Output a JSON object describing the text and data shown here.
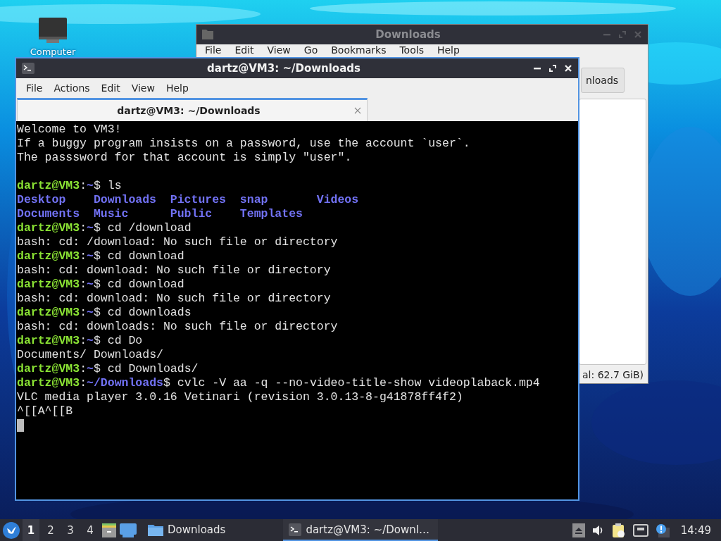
{
  "desktop_icons": [
    {
      "label": "Computer"
    }
  ],
  "file_manager": {
    "title": "Downloads",
    "focused": false,
    "menu": [
      "File",
      "Edit",
      "View",
      "Go",
      "Bookmarks",
      "Tools",
      "Help"
    ],
    "path_button": "nloads",
    "status": "al: 62.7 GiB)"
  },
  "terminal": {
    "title": "dartz@VM3: ~/Downloads",
    "focused": true,
    "menu": [
      "File",
      "Actions",
      "Edit",
      "View",
      "Help"
    ],
    "tabs": [
      {
        "label": "dartz@VM3: ~/Downloads",
        "selected": true
      }
    ],
    "lines": [
      {
        "kind": "text",
        "segments": [
          {
            "text": "Welcome to VM3!",
            "kind": "plain"
          }
        ]
      },
      {
        "kind": "text",
        "segments": [
          {
            "text": "If a buggy program insists on a password, use the account `user`.",
            "kind": "plain"
          }
        ]
      },
      {
        "kind": "text",
        "segments": [
          {
            "text": "The passsword for that account is simply \"user\".",
            "kind": "plain"
          }
        ]
      },
      {
        "kind": "blank"
      },
      {
        "kind": "text",
        "segments": [
          {
            "text": "dartz@VM3",
            "kind": "user"
          },
          {
            "text": ":",
            "kind": "plain"
          },
          {
            "text": "~",
            "kind": "path"
          },
          {
            "text": "$ ls",
            "kind": "plain"
          }
        ]
      },
      {
        "kind": "columns",
        "cells": [
          {
            "text": "Desktop",
            "kind": "dir"
          },
          {
            "text": "Downloads",
            "kind": "dir"
          },
          {
            "text": "Pictures",
            "kind": "dir"
          },
          {
            "text": "snap",
            "kind": "dir"
          },
          {
            "text": "Videos",
            "kind": "dir"
          }
        ]
      },
      {
        "kind": "columns",
        "cells": [
          {
            "text": "Documents",
            "kind": "dir"
          },
          {
            "text": "Music",
            "kind": "dir"
          },
          {
            "text": "Public",
            "kind": "dir"
          },
          {
            "text": "Templates",
            "kind": "dir"
          }
        ]
      },
      {
        "kind": "text",
        "segments": [
          {
            "text": "dartz@VM3",
            "kind": "user"
          },
          {
            "text": ":",
            "kind": "plain"
          },
          {
            "text": "~",
            "kind": "path"
          },
          {
            "text": "$ cd /download",
            "kind": "plain"
          }
        ]
      },
      {
        "kind": "text",
        "segments": [
          {
            "text": "bash: cd: /download: No such file or directory",
            "kind": "plain"
          }
        ]
      },
      {
        "kind": "text",
        "segments": [
          {
            "text": "dartz@VM3",
            "kind": "user"
          },
          {
            "text": ":",
            "kind": "plain"
          },
          {
            "text": "~",
            "kind": "path"
          },
          {
            "text": "$ cd download",
            "kind": "plain"
          }
        ]
      },
      {
        "kind": "text",
        "segments": [
          {
            "text": "bash: cd: download: No such file or directory",
            "kind": "plain"
          }
        ]
      },
      {
        "kind": "text",
        "segments": [
          {
            "text": "dartz@VM3",
            "kind": "user"
          },
          {
            "text": ":",
            "kind": "plain"
          },
          {
            "text": "~",
            "kind": "path"
          },
          {
            "text": "$ cd download",
            "kind": "plain"
          }
        ]
      },
      {
        "kind": "text",
        "segments": [
          {
            "text": "bash: cd: download: No such file or directory",
            "kind": "plain"
          }
        ]
      },
      {
        "kind": "text",
        "segments": [
          {
            "text": "dartz@VM3",
            "kind": "user"
          },
          {
            "text": ":",
            "kind": "plain"
          },
          {
            "text": "~",
            "kind": "path"
          },
          {
            "text": "$ cd downloads",
            "kind": "plain"
          }
        ]
      },
      {
        "kind": "text",
        "segments": [
          {
            "text": "bash: cd: downloads: No such file or directory",
            "kind": "plain"
          }
        ]
      },
      {
        "kind": "text",
        "segments": [
          {
            "text": "dartz@VM3",
            "kind": "user"
          },
          {
            "text": ":",
            "kind": "plain"
          },
          {
            "text": "~",
            "kind": "path"
          },
          {
            "text": "$ cd Do",
            "kind": "plain"
          }
        ]
      },
      {
        "kind": "text",
        "segments": [
          {
            "text": "Documents/ Downloads/",
            "kind": "plain"
          }
        ]
      },
      {
        "kind": "text",
        "segments": [
          {
            "text": "dartz@VM3",
            "kind": "user"
          },
          {
            "text": ":",
            "kind": "plain"
          },
          {
            "text": "~",
            "kind": "path"
          },
          {
            "text": "$ cd Downloads/",
            "kind": "plain"
          }
        ]
      },
      {
        "kind": "text",
        "segments": [
          {
            "text": "dartz@VM3",
            "kind": "user"
          },
          {
            "text": ":",
            "kind": "plain"
          },
          {
            "text": "~/Downloads",
            "kind": "path"
          },
          {
            "text": "$ cvlc -V aa -q --no-video-title-show videoplaback.mp4",
            "kind": "plain"
          }
        ]
      },
      {
        "kind": "text",
        "segments": [
          {
            "text": "VLC media player 3.0.16 Vetinari (revision 3.0.13-8-g41878ff4f2)",
            "kind": "plain"
          }
        ]
      },
      {
        "kind": "text",
        "segments": [
          {
            "text": "^[[A^[[B",
            "kind": "plain"
          }
        ]
      },
      {
        "kind": "cursor"
      }
    ]
  },
  "taskbar": {
    "workspaces": [
      {
        "label": "1",
        "selected": true
      },
      {
        "label": "2",
        "selected": false
      },
      {
        "label": "3",
        "selected": false
      },
      {
        "label": "4",
        "selected": false
      }
    ],
    "tasks": [
      {
        "label": "Downloads",
        "kind": "folder",
        "selected": false
      },
      {
        "label": "dartz@VM3: ~/Downl…",
        "kind": "terminal",
        "selected": true
      }
    ],
    "clock": "14:49"
  }
}
